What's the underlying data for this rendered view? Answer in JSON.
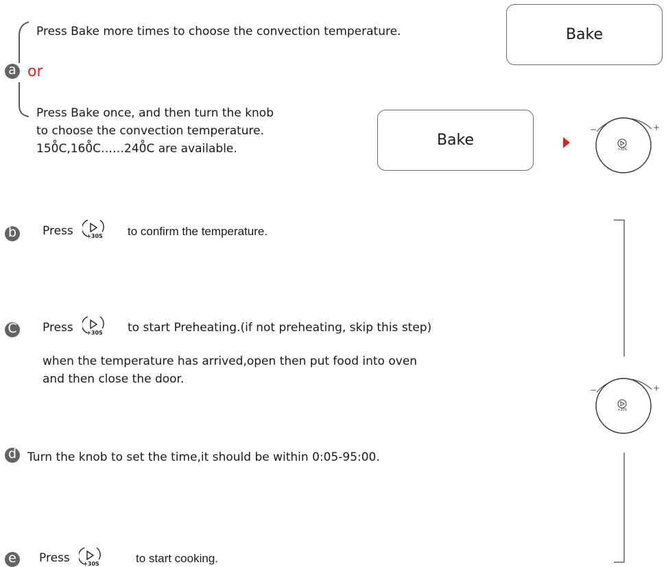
{
  "step_a": {
    "badge": "a",
    "option1": "Press Bake more times to choose the convection temperature.",
    "or": "or",
    "option2_line1": "Press Bake once, and then turn the knob",
    "option2_line2": "to choose the convection temperature.",
    "option2_line3": "150̊C,160̊C……240̊C are available."
  },
  "step_b": {
    "badge": "b",
    "prefix": "Press",
    "suffix": "to confirm  the temperature."
  },
  "step_c": {
    "badge": "C",
    "prefix": "Press",
    "suffix": "to start Preheating.(if not preheating, skip this step)",
    "line2": "when the temperature has arrived,open then put food into oven",
    "line3": "and then close the door."
  },
  "step_d": {
    "badge": "d",
    "text": "Turn the knob to set the time,it should be within 0:05-95:00."
  },
  "step_e": {
    "badge": "e",
    "prefix": "Press",
    "suffix": "to start cooking."
  },
  "keys": {
    "bake_top": "Bake",
    "bake_mid": "Bake"
  },
  "button_symbol": {
    "label": "+30S",
    "icon": "start-plus-30s-icon"
  },
  "knob": {
    "minus": "−",
    "plus": "+",
    "icon": "knob-icon"
  },
  "colors": {
    "accent_red": "#e02121",
    "badge_gray": "#636363",
    "line_gray": "#6b6b6b"
  }
}
